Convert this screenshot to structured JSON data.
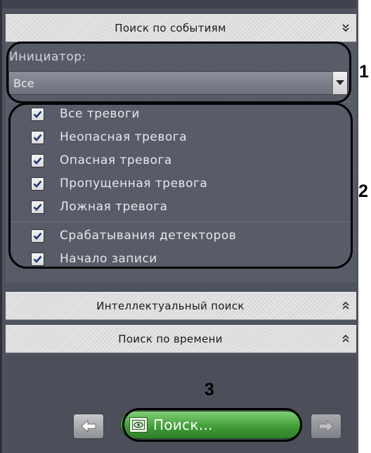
{
  "panel": {
    "event_search_header": "Поиск по событиям",
    "initiator_label": "Инициатор:",
    "initiator_value": "Все",
    "checkboxes_group1": [
      {
        "label": "Все тревоги",
        "checked": true
      },
      {
        "label": "Неопасная тревога",
        "checked": true
      },
      {
        "label": "Опасная тревога",
        "checked": true
      },
      {
        "label": "Пропущенная тревога",
        "checked": true
      },
      {
        "label": "Ложная тревога",
        "checked": true
      }
    ],
    "checkboxes_group2": [
      {
        "label": "Срабатывания детекторов",
        "checked": true
      },
      {
        "label": "Начало записи",
        "checked": true
      }
    ],
    "intelligent_search_header": "Интеллектуальный поиск",
    "time_search_header": "Поиск по времени",
    "search_button_label": "Поиск..."
  },
  "callouts": [
    "1",
    "2",
    "3"
  ],
  "icons": {
    "collapse": "double-chevron-down-icon",
    "expand": "double-chevron-up-icon",
    "dropdown": "triangle-down-icon",
    "back": "arrow-left-icon",
    "forward": "arrow-right-icon",
    "search": "eye-film-icon",
    "checkbox": "checkmark-icon"
  },
  "colors": {
    "panel_bg": "#4f535f",
    "search_button": "#3f9a36",
    "header_bg": "#e4e4e4",
    "annotation": "#000000"
  }
}
